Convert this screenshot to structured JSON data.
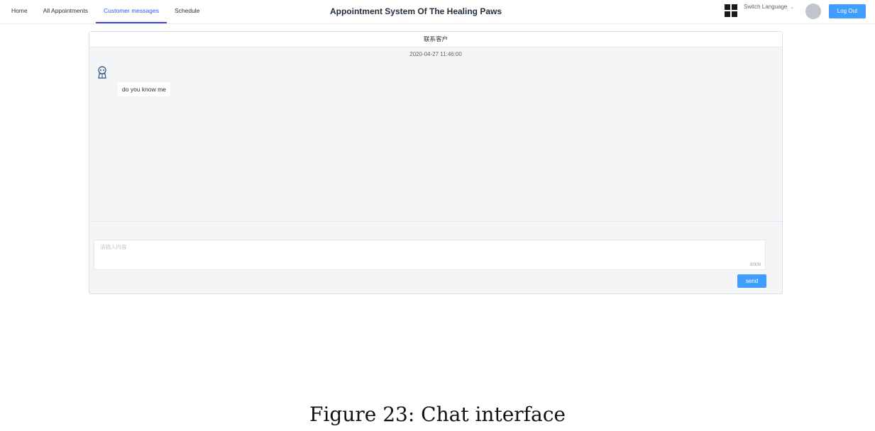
{
  "nav": {
    "items": [
      {
        "label": "Home"
      },
      {
        "label": "All Appointments"
      },
      {
        "label": "Customer messages"
      },
      {
        "label": "Schedule"
      }
    ]
  },
  "header": {
    "title": "Appointment System Of The Healing Paws",
    "switch_language": "Switch Language",
    "logout": "Log Out"
  },
  "chat": {
    "title": "联系客户",
    "timestamp": "2020-04-27 11:46:00",
    "messages": [
      {
        "text": "do you know me"
      }
    ],
    "input": {
      "placeholder": "请输入内容",
      "value": "",
      "counter": "0/300"
    },
    "send_label": "send"
  },
  "caption": "Figure 23: Chat interface",
  "colors": {
    "accent": "#409eff",
    "active_nav": "#3a55f0",
    "panel_bg": "#f4f5f7"
  },
  "icons": [
    "grid-icon",
    "chevron-down-icon",
    "user-avatar",
    "robot-avatar-icon"
  ]
}
